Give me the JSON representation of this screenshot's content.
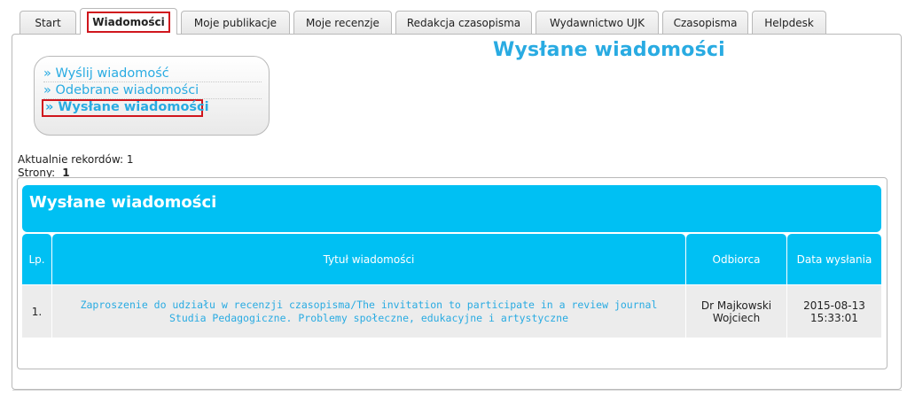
{
  "tabs": [
    "Start",
    "Wiadomości",
    "Moje publikacje",
    "Moje recenzje",
    "Redakcja czasopisma",
    "Wydawnictwo UJK",
    "Czasopisma",
    "Helpdesk"
  ],
  "active_tab": "Wiadomości",
  "page_title": "Wysłane wiadomości",
  "side_menu": {
    "items": [
      "» Wyślij wiadomość",
      "» Odebrane wiadomości",
      "» Wysłane wiadomości"
    ],
    "active": "» Wysłane wiadomości"
  },
  "records": {
    "current_label": "Aktualnie rekordów:",
    "current_value": "1",
    "pages_label": "Strony:",
    "pages_value": "1"
  },
  "table": {
    "title": "Wysłane wiadomości",
    "columns": [
      "Lp.",
      "Tytuł wiadomości",
      "Odbiorca",
      "Data wysłania"
    ],
    "rows": [
      {
        "lp": "1.",
        "title": "Zaproszenie do udziału w recenzji czasopisma/The invitation to participate in a review journal Studia Pedagogiczne. Problemy społeczne, edukacyjne i artystyczne",
        "recipient": "Dr Majkowski Wojciech",
        "date": "2015-08-13 15:33:01"
      }
    ]
  },
  "colors": {
    "accent": "#29abe2",
    "header_bg": "#00c0f3",
    "highlight_border": "#d0161d"
  }
}
